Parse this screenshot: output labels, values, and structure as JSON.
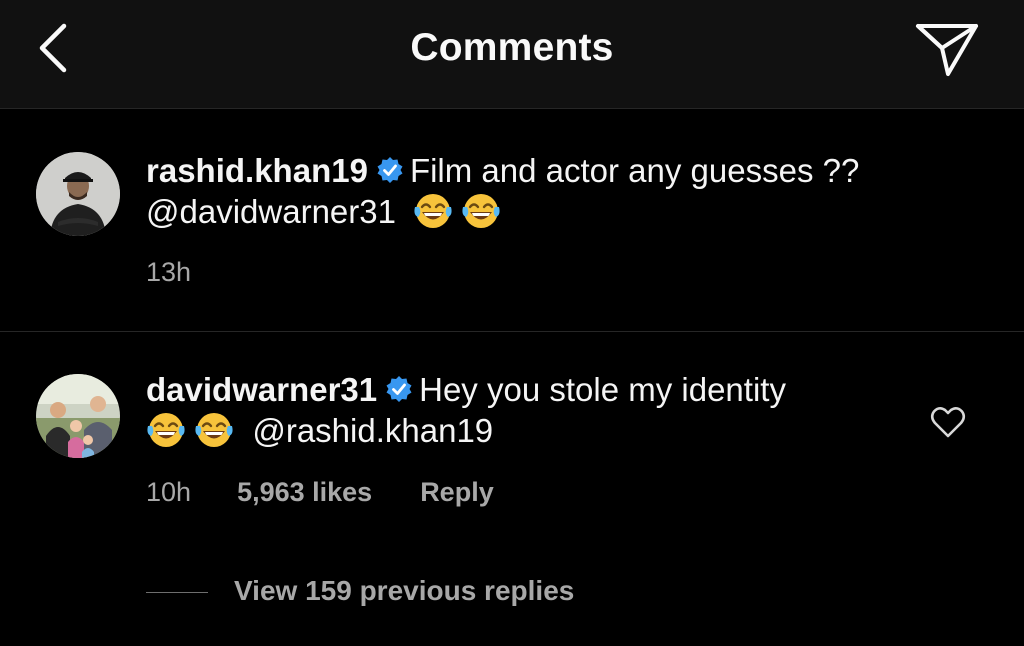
{
  "header": {
    "title": "Comments",
    "back_icon": "chevron-left-icon",
    "send_icon": "paper-plane-icon"
  },
  "comments": [
    {
      "username": "rashid.khan19",
      "verified": true,
      "text": "Film and actor any guesses ??",
      "mention": "@davidwarner31",
      "emojis": [
        "😂",
        "😂"
      ],
      "time": "13h"
    },
    {
      "username": "davidwarner31",
      "verified": true,
      "text": "Hey you stole my identity",
      "emojis": [
        "😂",
        "😂"
      ],
      "mention": "@rashid.khan19",
      "time": "10h",
      "likes": "5,963 likes",
      "reply": "Reply"
    }
  ],
  "view_replies": "View 159 previous replies",
  "colors": {
    "background": "#000000",
    "header_bg": "#111111",
    "text": "#f5f5f5",
    "secondary_text": "#a8a8a8",
    "verified_badge": "#3897f0"
  }
}
